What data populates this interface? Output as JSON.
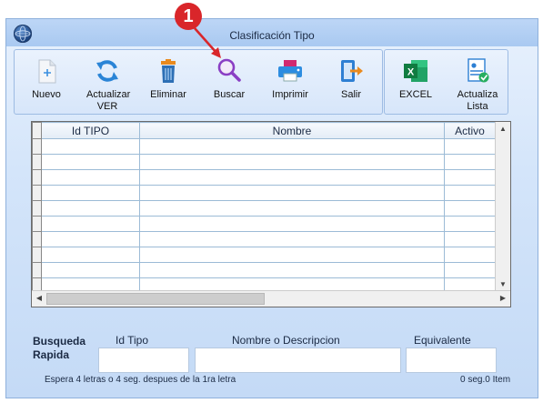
{
  "window": {
    "title": "Clasificación Tipo"
  },
  "annotation": {
    "badge_number": "1",
    "color": "#d9262a"
  },
  "toolbar": {
    "buttons": [
      {
        "id": "nuevo",
        "label": "Nuevo",
        "icon": "new-document-icon"
      },
      {
        "id": "actualizar",
        "label": "Actualizar VER",
        "icon": "refresh-icon"
      },
      {
        "id": "eliminar",
        "label": "Eliminar",
        "icon": "trash-icon"
      },
      {
        "id": "buscar",
        "label": "Buscar",
        "icon": "search-icon"
      },
      {
        "id": "imprimir",
        "label": "Imprimir",
        "icon": "printer-icon"
      },
      {
        "id": "salir",
        "label": "Salir",
        "icon": "exit-icon"
      }
    ],
    "extra_buttons": [
      {
        "id": "excel",
        "label": "EXCEL",
        "icon": "excel-icon"
      },
      {
        "id": "actualiza-lista",
        "label": "Actualiza Lista",
        "icon": "update-list-icon"
      }
    ]
  },
  "grid": {
    "columns": [
      "Id TIPO",
      "Nombre",
      "Activo"
    ]
  },
  "search": {
    "heading": "Busqueda Rapida",
    "id_label": "Id Tipo",
    "name_label": "Nombre o Descripcion",
    "equiv_label": "Equivalente",
    "id_value": "",
    "name_value": "",
    "equiv_value": "",
    "hint": "Espera 4 letras o 4 seg. despues de la 1ra letra",
    "status": "0 seg.0 Item"
  }
}
